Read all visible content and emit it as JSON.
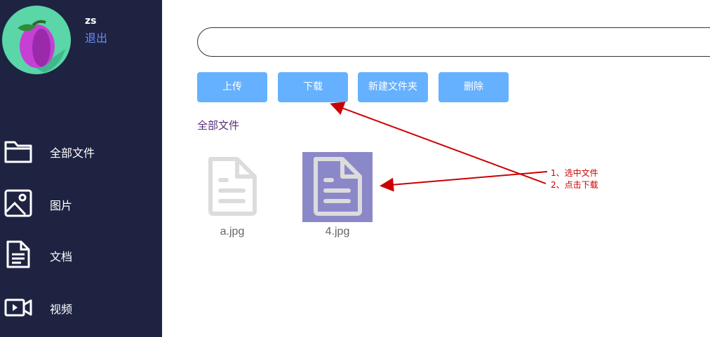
{
  "user": {
    "name": "zs",
    "logout_label": "退出"
  },
  "sidebar": {
    "items": [
      {
        "label": "全部文件",
        "icon": "folder-icon"
      },
      {
        "label": "图片",
        "icon": "image-icon"
      },
      {
        "label": "文档",
        "icon": "document-icon"
      },
      {
        "label": "视频",
        "icon": "video-icon"
      }
    ]
  },
  "search": {
    "value": "",
    "placeholder": ""
  },
  "toolbar": {
    "upload_label": "上传",
    "download_label": "下载",
    "new_folder_label": "新建文件夹",
    "delete_label": "删除"
  },
  "breadcrumb": "全部文件",
  "files": [
    {
      "name": "a.jpg",
      "icon": "file-icon",
      "selected": false
    },
    {
      "name": "4.jpg",
      "icon": "file-icon",
      "selected": true
    }
  ],
  "annotation": {
    "step1": "1、选中文件",
    "step2": "2、点击下载"
  },
  "colors": {
    "sidebar_bg": "#1e2342",
    "accent_button": "#66b1ff",
    "logout_link": "#6b8df5",
    "selected_file_bg": "#8b88c9",
    "annotation_red": "#cc0000"
  }
}
